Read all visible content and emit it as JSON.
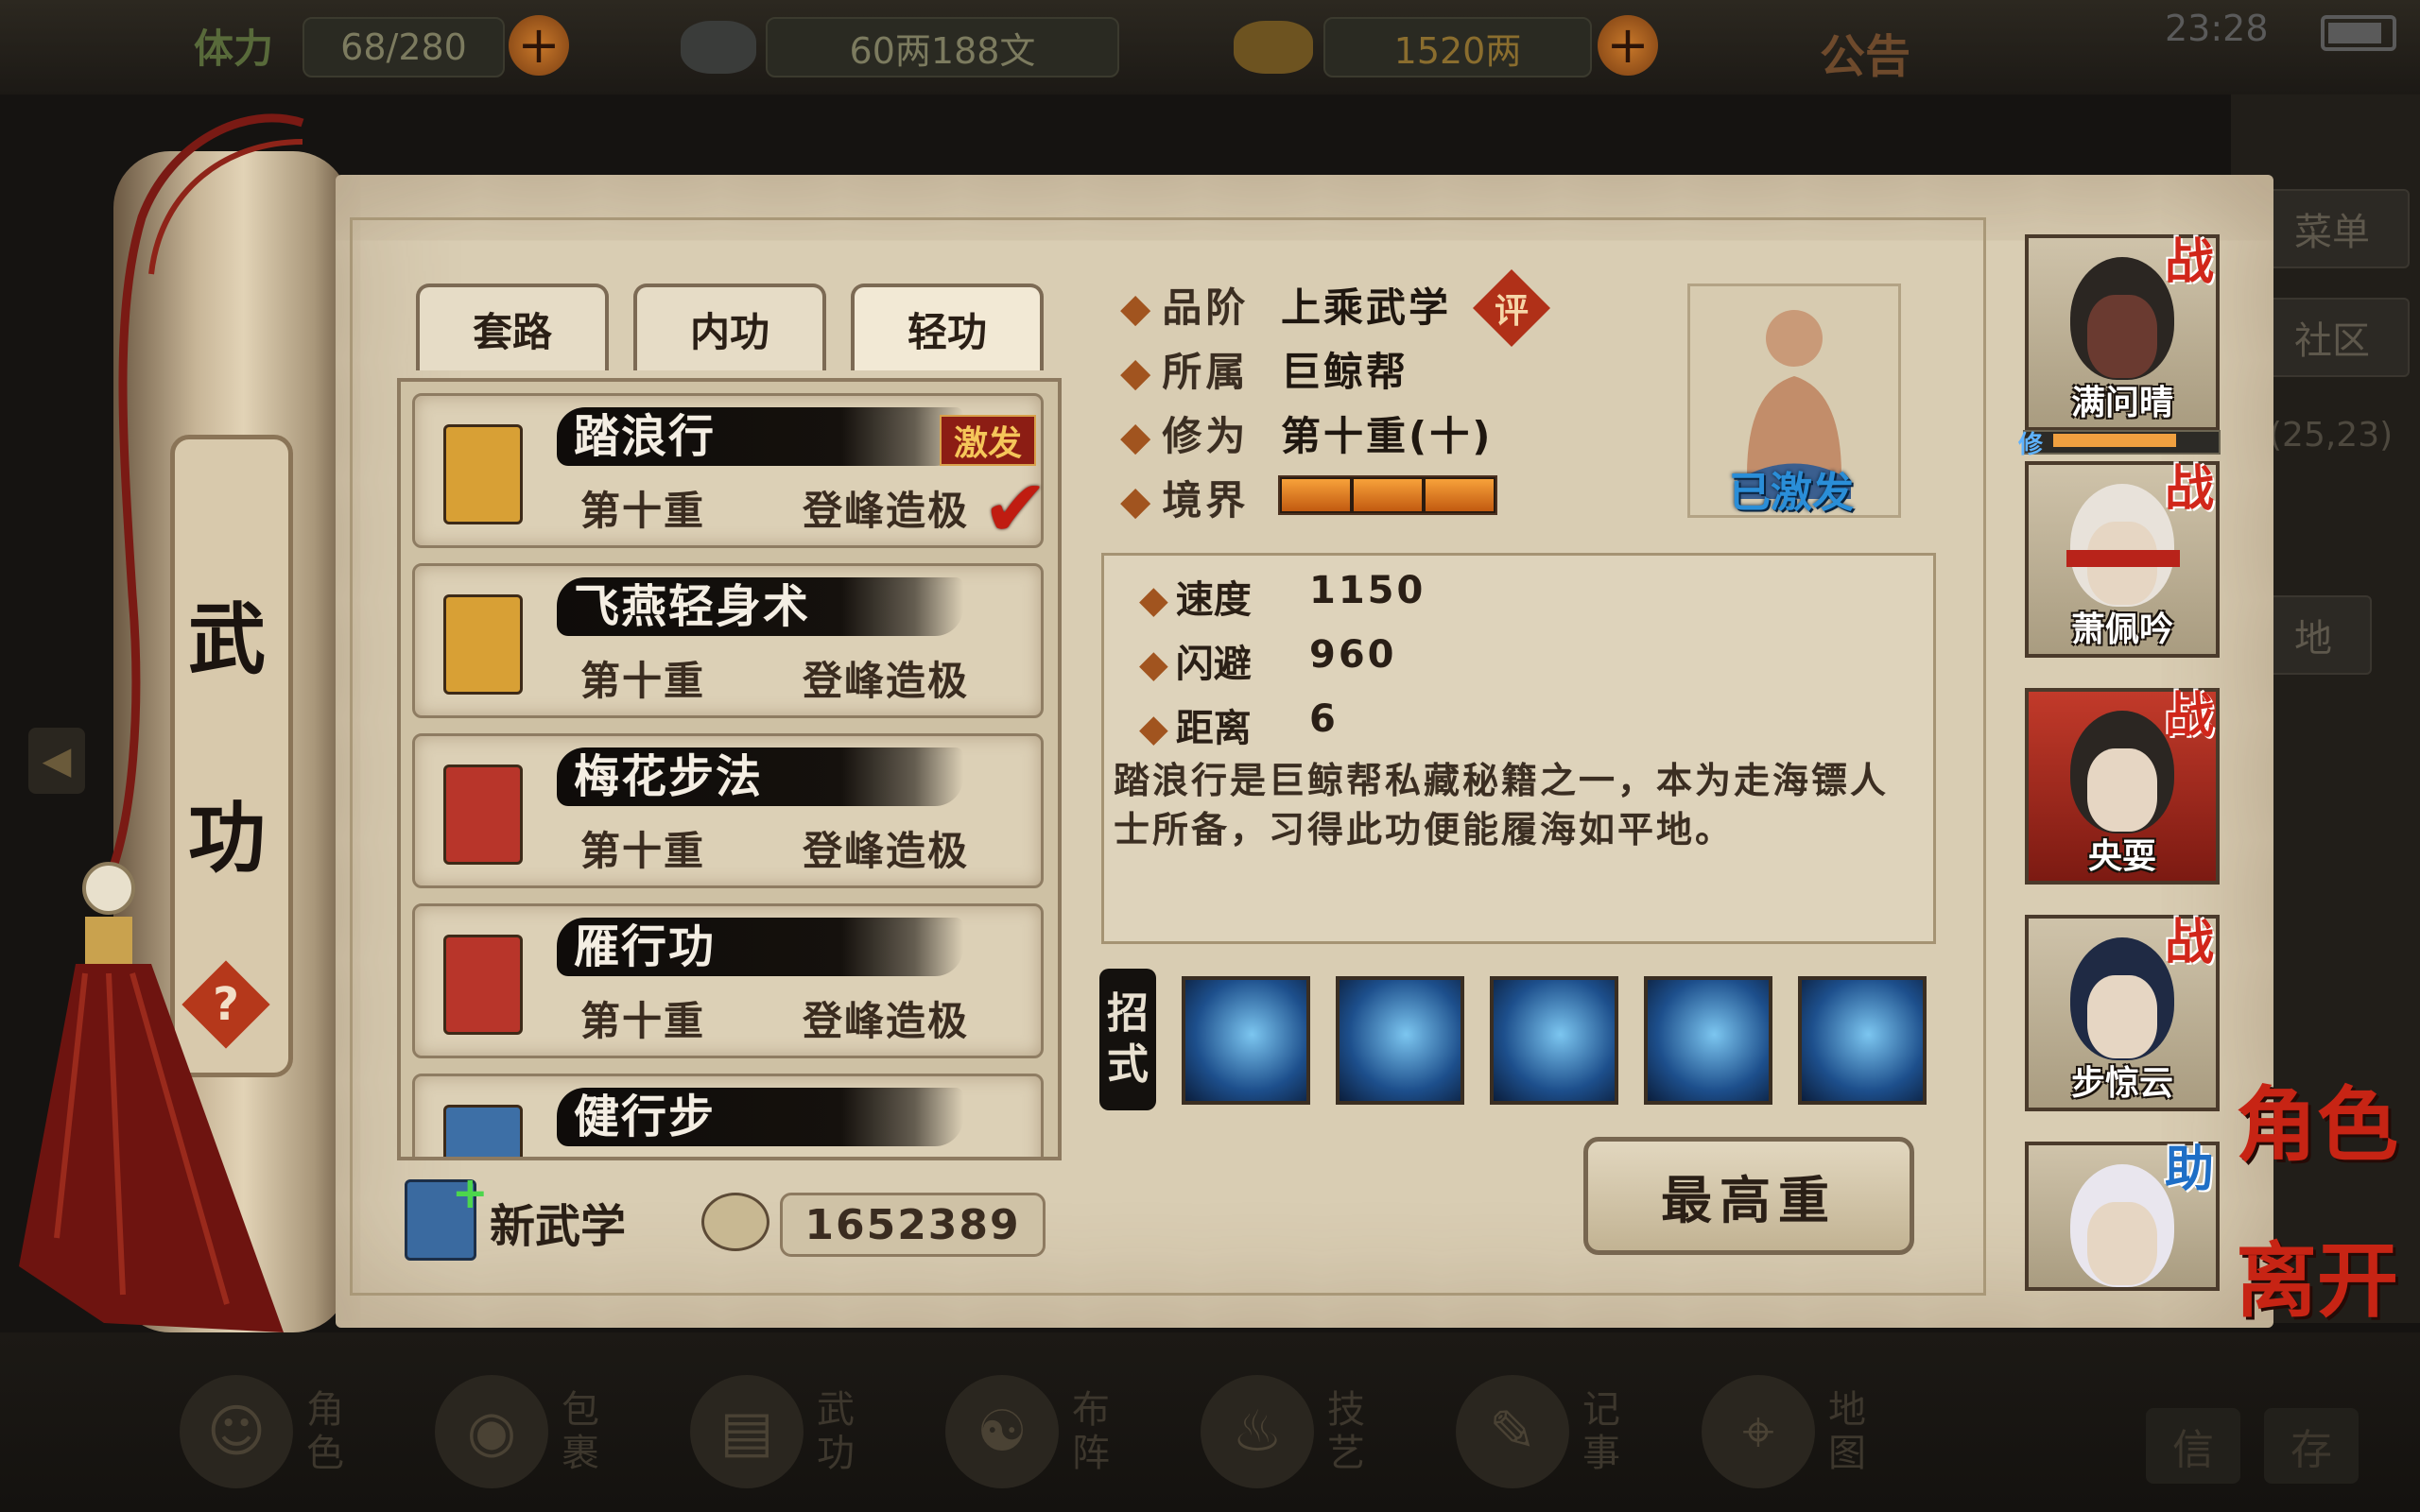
{
  "topbar": {
    "stamina_label": "体力",
    "stamina_value": "68/280",
    "silver_value": "60两188文",
    "gold_value": "1520两",
    "notice_label": "公告",
    "clock": "23:28"
  },
  "side": {
    "menu_label": "菜单",
    "community_label": "社区",
    "coords": "(25,23)",
    "map_label": "地"
  },
  "scroll": {
    "title_char_1": "武",
    "title_char_2": "功",
    "help_symbol": "?"
  },
  "tabs": [
    {
      "label": "套路"
    },
    {
      "label": "内功"
    },
    {
      "label": "轻功"
    }
  ],
  "skills": [
    {
      "name": "踏浪行",
      "level": "第十重",
      "rank": "登峰造极",
      "badge": "激发",
      "checked": true,
      "book_color": "#d8a035"
    },
    {
      "name": "飞燕轻身术",
      "level": "第十重",
      "rank": "登峰造极",
      "book_color": "#d8a035"
    },
    {
      "name": "梅花步法",
      "level": "第十重",
      "rank": "登峰造极",
      "book_color": "#b8352a"
    },
    {
      "name": "雁行功",
      "level": "第十重",
      "rank": "登峰造极",
      "book_color": "#b8352a"
    },
    {
      "name": "健行步",
      "level": "",
      "rank": "",
      "book_color": "#3d6fa6"
    }
  ],
  "list_footer": {
    "new_skill_label": "新武学",
    "points": "1652389"
  },
  "info": {
    "grade_label": "品阶",
    "grade_value": "上乘武学",
    "rate_badge": "评",
    "faction_label": "所属",
    "faction_value": "巨鲸帮",
    "cultivation_label": "修为",
    "cultivation_value": "第十重(十)",
    "realm_label": "境界",
    "realm_level": 3,
    "portrait_label": "已激发"
  },
  "stats": [
    {
      "label": "速度",
      "value": "1150"
    },
    {
      "label": "闪避",
      "value": "960"
    },
    {
      "label": "距离",
      "value": "6"
    }
  ],
  "description": "踏浪行是巨鲸帮私藏秘籍之一，本为走海镖人士所备，习得此功便能履海如平地。",
  "moves": {
    "label_1": "招",
    "label_2": "式",
    "count": 5
  },
  "max_button_label": "最高重",
  "characters": [
    {
      "name": "满问晴",
      "tag": "战"
    },
    {
      "name": "萧佩吟",
      "tag": "战"
    },
    {
      "name": "央耍",
      "tag": "战"
    },
    {
      "name": "步惊云",
      "tag": "战"
    },
    {
      "name": "",
      "tag": "助"
    }
  ],
  "cultivation_badge": "修",
  "right_actions": {
    "role_label": "角色",
    "leave_label": "离开"
  },
  "bottom_nav": [
    {
      "label": "角色",
      "icon": "character-icon"
    },
    {
      "label": "包裹",
      "icon": "bag-icon"
    },
    {
      "label": "武功",
      "icon": "books-icon"
    },
    {
      "label": "布阵",
      "icon": "bagua-icon"
    },
    {
      "label": "技艺",
      "icon": "teapot-icon"
    },
    {
      "label": "记事",
      "icon": "scroll-icon"
    },
    {
      "label": "地图",
      "icon": "map-icon"
    },
    {
      "label": "信",
      "icon": "letter-icon"
    },
    {
      "label": "存",
      "icon": "save-icon"
    }
  ]
}
